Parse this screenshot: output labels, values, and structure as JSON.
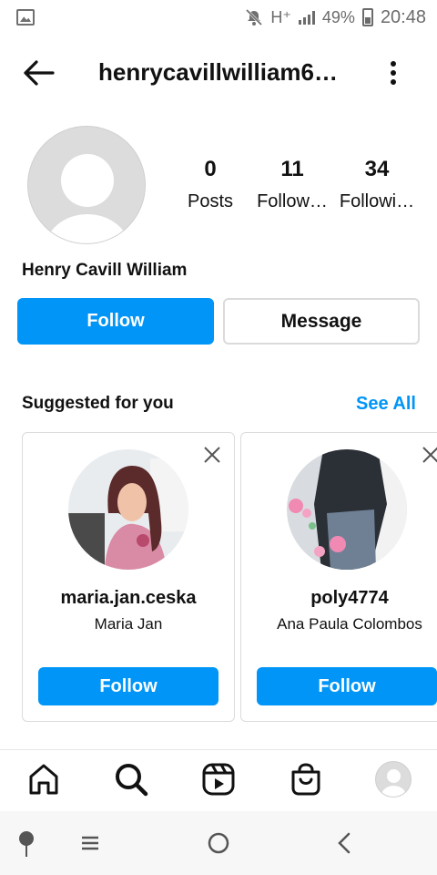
{
  "status_bar": {
    "network": "H⁺",
    "battery": "49%",
    "time": "20:48",
    "icons": [
      "gallery-icon",
      "mute-icon",
      "signal-icon",
      "battery-icon"
    ]
  },
  "header": {
    "username": "henrycavillwilliam6…",
    "back_icon": "arrow-left-icon",
    "more_icon": "more-vertical-icon"
  },
  "profile": {
    "display_name": "Henry Cavill William",
    "stats": [
      {
        "value": "0",
        "label": "Posts"
      },
      {
        "value": "11",
        "label": "Follow…"
      },
      {
        "value": "34",
        "label": "Followi…"
      }
    ],
    "follow_label": "Follow",
    "message_label": "Message"
  },
  "suggested": {
    "title": "Suggested for you",
    "see_all": "See All",
    "cards": [
      {
        "handle": "maria.jan.ceska",
        "name": "Maria Jan",
        "follow_label": "Follow"
      },
      {
        "handle": "poly4774",
        "name": "Ana Paula Colombos",
        "follow_label": "Follow"
      }
    ]
  },
  "bottom_nav": [
    "home-icon",
    "search-icon",
    "reels-icon",
    "shop-icon",
    "profile-avatar"
  ],
  "system_nav": [
    "assistant-icon",
    "recents-icon",
    "home-circle-icon",
    "back-chevron-icon"
  ],
  "colors": {
    "accent": "#0095f6",
    "border": "#dbdbdb",
    "text": "#111111"
  }
}
